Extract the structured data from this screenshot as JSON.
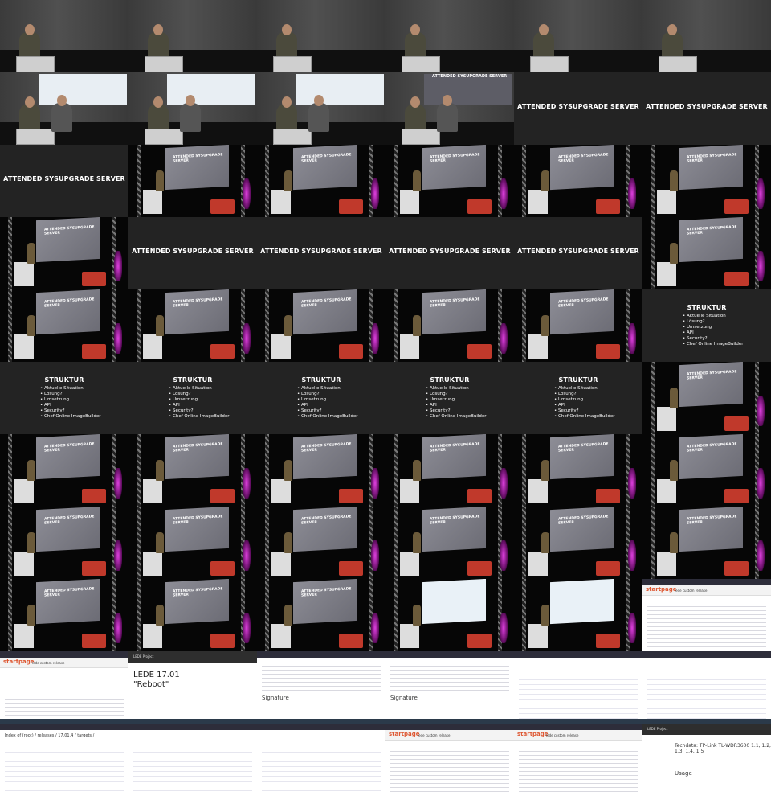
{
  "slide_title": "ATTENDED SYSUPGRADE SERVER",
  "struktur": {
    "title": "STRUKTUR",
    "items": [
      "Aktuelle Situation",
      "Lösung?",
      "Umsetzung",
      "API",
      "Security?",
      "Chef Online ImageBuilder"
    ]
  },
  "browser": {
    "brand": "startpage",
    "query": "lede custom release",
    "index_title": "Index of (root) / releases / 17.01.4 / targets /",
    "lede_project": "LEDE Project",
    "release_title": "LEDE 17.01",
    "release_name": "\"Reboot\"",
    "signature": "Signature",
    "techdata": "Techdata: TP-Link TL-WDR3600 1.1, 1.2, 1.3, 1.4, 1.5",
    "usage": "Usage"
  },
  "tiles": [
    "stage",
    "stage",
    "stage",
    "stage",
    "stage",
    "stage",
    "stage-proj",
    "stage-proj",
    "stage-proj",
    "stage-proj-title",
    "slide",
    "slide",
    "slide",
    "dark",
    "dark",
    "dark",
    "dark",
    "dark",
    "dark",
    "slide",
    "slide",
    "slide",
    "slide",
    "dark",
    "dark",
    "dark",
    "dark",
    "dark",
    "dark",
    "struktur",
    "struktur",
    "struktur",
    "struktur",
    "struktur",
    "struktur",
    "dark",
    "dark",
    "dark",
    "dark",
    "dark",
    "dark",
    "dark",
    "dark",
    "dark",
    "dark",
    "dark",
    "dark",
    "dark",
    "dark",
    "dark",
    "dark",
    "dark-web",
    "dark-web",
    "web-search",
    "web-search",
    "web-lede",
    "web-text",
    "web-text",
    "web-list",
    "web-list",
    "web-index",
    "web-list",
    "web-list",
    "web-search",
    "web-search",
    "web-tech"
  ]
}
